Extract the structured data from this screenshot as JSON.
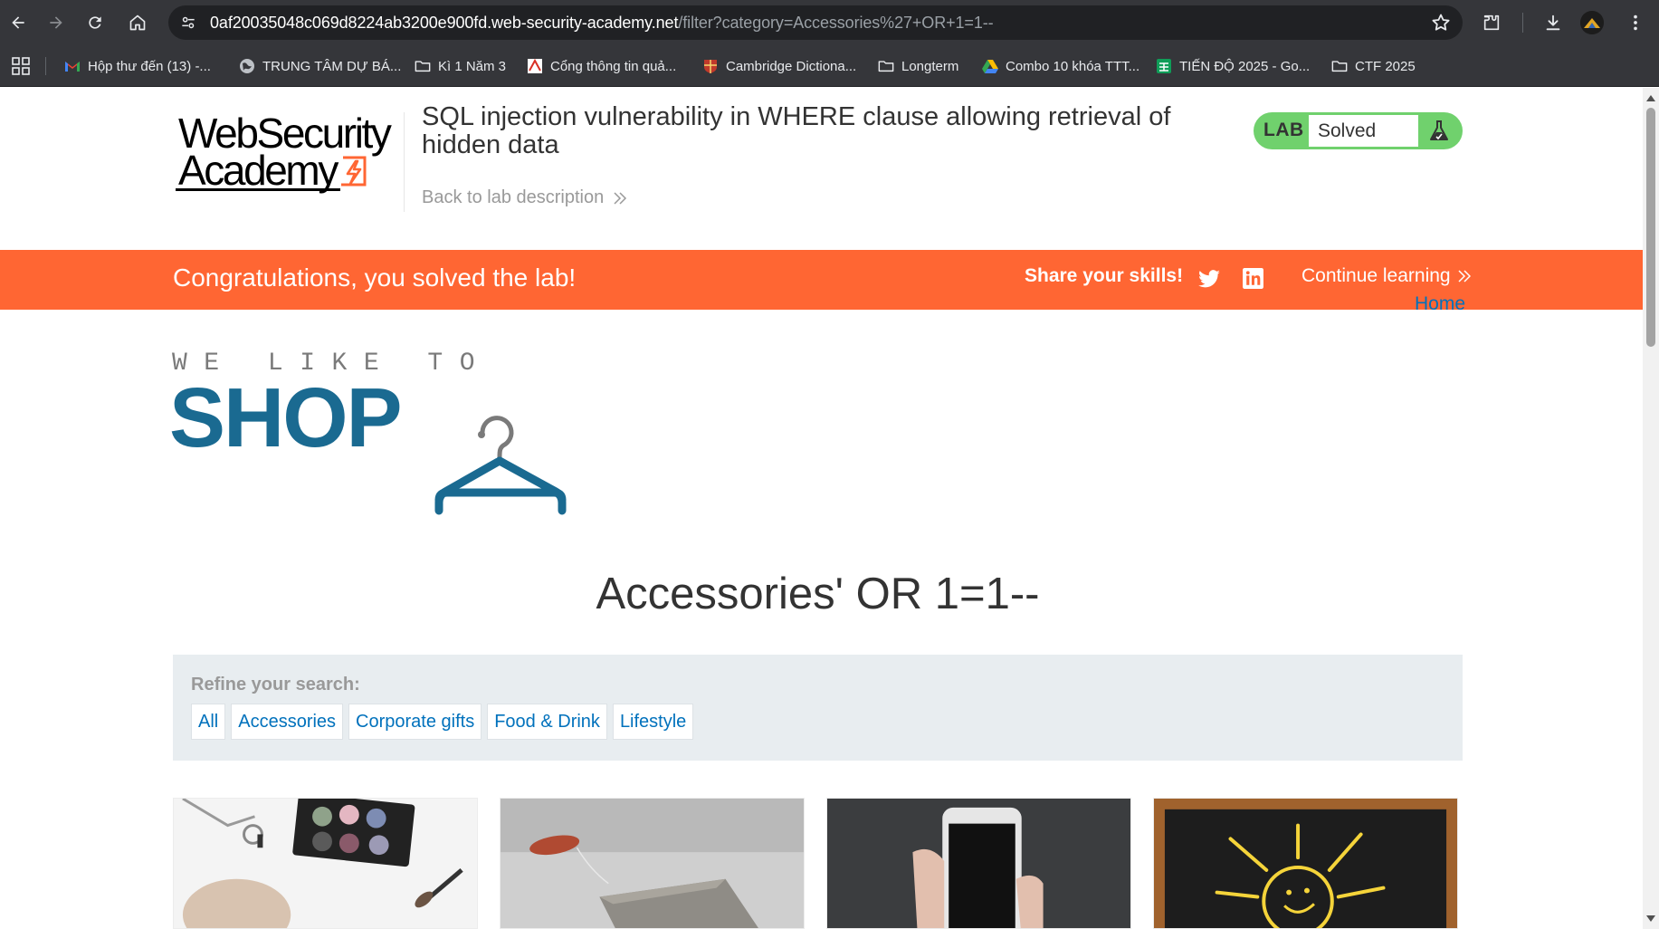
{
  "browser": {
    "url_host": "0af20035048c069d8224ab3200e900fd.web-security-academy.net",
    "url_path": "/filter?category=Accessories%27+OR+1=1--",
    "icons": [
      "back-icon",
      "forward-icon",
      "reload-icon",
      "home-icon",
      "site-info-icon",
      "star-icon",
      "extensions-icon",
      "download-icon",
      "profile-avatar",
      "more-menu-icon"
    ]
  },
  "bookmarks": [
    {
      "label": "Hộp thư đến (13) -...",
      "icon": "gmail-icon"
    },
    {
      "label": "TRUNG TÂM DỰ BÁ...",
      "icon": "globe-icon"
    },
    {
      "label": "Kì 1 Năm 3",
      "icon": "folder-icon"
    },
    {
      "label": "Cổng thông tin quả...",
      "icon": "portal-icon"
    },
    {
      "label": "Cambridge Dictiona...",
      "icon": "cambridge-icon"
    },
    {
      "label": "Longterm",
      "icon": "folder-icon"
    },
    {
      "label": "Combo 10 khóa TTT...",
      "icon": "drive-icon"
    },
    {
      "label": "TIẾN ĐỘ 2025 - Go...",
      "icon": "sheets-icon"
    },
    {
      "label": "CTF 2025",
      "icon": "folder-icon"
    }
  ],
  "header": {
    "logo_line1": "WebSecurity",
    "logo_line2": "Academy",
    "lab_title": "SQL injection vulnerability in WHERE clause allowing retrieval of hidden data",
    "back_link": "Back to lab description",
    "lab_badge_word": "LAB",
    "lab_status": "Solved"
  },
  "banner": {
    "message": "Congratulations, you solved the lab!",
    "share": "Share your skills!",
    "continue": "Continue learning"
  },
  "nav": {
    "home": "Home"
  },
  "shop_logo": {
    "tagline": "WE LIKE TO",
    "word": "SHOP"
  },
  "category_heading": "Accessories' OR 1=1--",
  "filter": {
    "refine_label": "Refine your search:",
    "links": [
      "All",
      "Accessories",
      "Corporate gifts",
      "Food & Drink",
      "Lifestyle"
    ]
  },
  "colors": {
    "banner": "#ff6633",
    "lab_badge": "#70d16d",
    "link": "#0071bc",
    "shop_blue": "#1a6a91",
    "filter_bg": "#e8edf0"
  }
}
